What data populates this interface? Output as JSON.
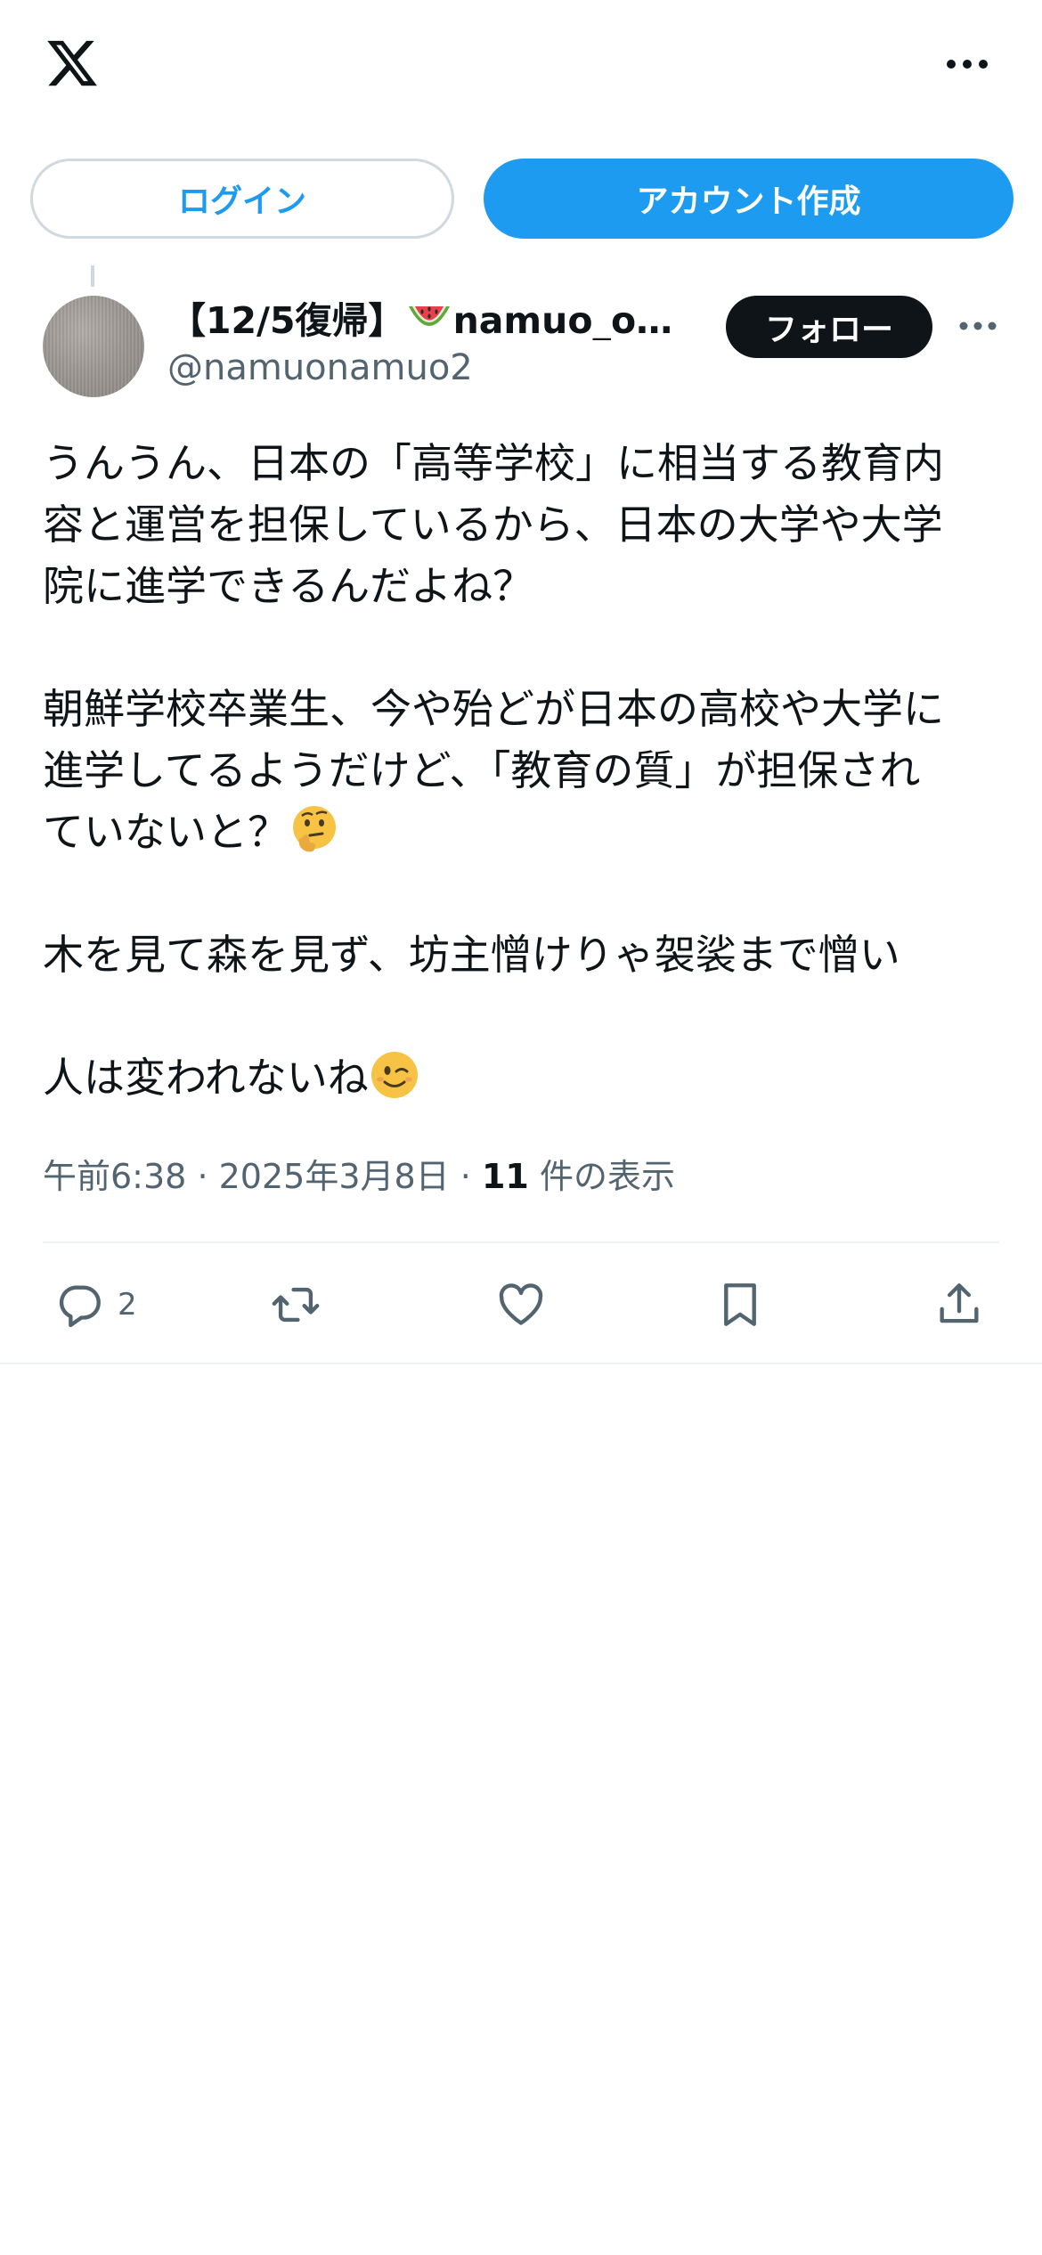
{
  "header": {
    "logo_icon": "x-logo-icon",
    "more_icon": "more-horizontal-icon"
  },
  "auth": {
    "login_label": "ログイン",
    "signup_label": "アカウント作成"
  },
  "author": {
    "display_name_prefix": "【12/5復帰】",
    "display_name_suffix": "namuo_o…",
    "name_emoji": "watermelon",
    "handle": "@namuonamuo2",
    "follow_label": "フォロー"
  },
  "tweet": {
    "paragraphs": [
      "うんうん、日本の「高等学校」に相当する教育内\n容と運営を担保しているから、日本の大学や大学\n院に進学できるんだよね？",
      "朝鮮学校卒業生、今や殆どが日本の高校や大学に\n進学してるようだけど、「教育の質」が担保され\nていないと？",
      "木を見て森を見ず、坊主憎けりゃ袈裟まで憎い",
      "人は変われないね"
    ],
    "emojis": [
      "thinking-face",
      "winking-face"
    ]
  },
  "meta": {
    "time": "午前6:38",
    "separator": "·",
    "date": "2025年3月8日",
    "views_count": "11",
    "views_label": "件の表示"
  },
  "actions": {
    "reply_count": "2",
    "icons": [
      "reply-icon",
      "retweet-icon",
      "like-icon",
      "bookmark-icon",
      "share-icon"
    ]
  },
  "colors": {
    "accent": "#1d9bf0",
    "text": "#0f1419",
    "secondary_text": "#536471",
    "border": "#cfd9de",
    "divider": "#eff3f4"
  }
}
